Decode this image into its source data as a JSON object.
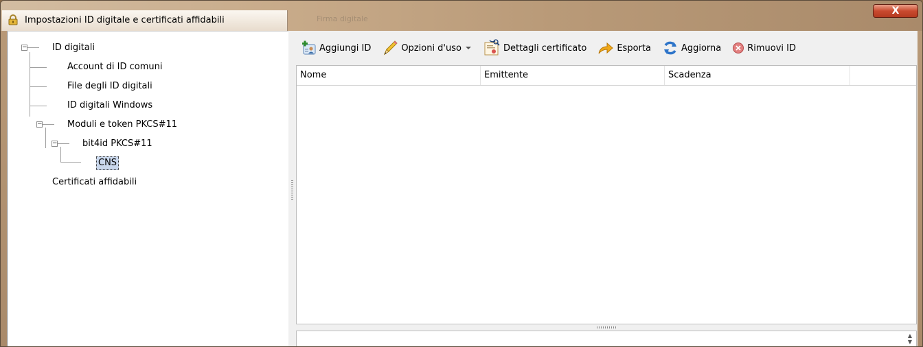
{
  "window": {
    "title": "Impostazioni ID digitale e certificati affidabili",
    "ghost_tab": "Firma digitale",
    "close_label": "X"
  },
  "tree": {
    "id_digitali": "ID digitali",
    "account_id_comuni": "Account di ID comuni",
    "file_id_digitali": "File degli ID digitali",
    "id_digitali_windows": "ID digitali Windows",
    "moduli_token": "Moduli e token PKCS#11",
    "bit4id": "bit4id PKCS#11",
    "cns": "CNS",
    "certificati_affidabili": "Certificati affidabili"
  },
  "toolbar": {
    "aggiungi_id": "Aggiungi ID",
    "opzioni_uso": "Opzioni d'uso",
    "dettagli_certificato": "Dettagli certificato",
    "esporta": "Esporta",
    "aggiorna": "Aggiorna",
    "rimuovi_id": "Rimuovi ID"
  },
  "table": {
    "columns": [
      "Nome",
      "Emittente",
      "Scadenza",
      ""
    ]
  },
  "colors": {
    "selection": "#c9d7ec",
    "close_button": "#c94a2f"
  }
}
